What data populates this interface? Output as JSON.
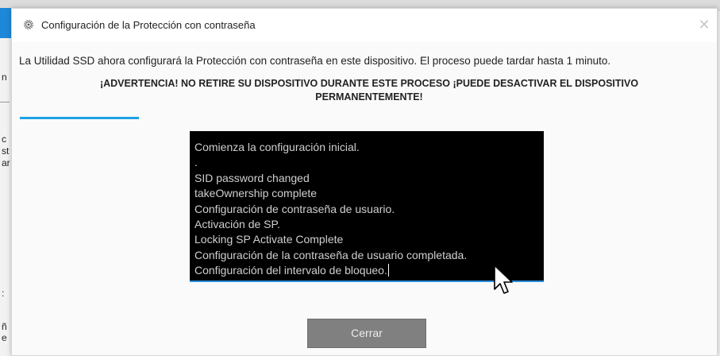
{
  "background": {
    "fragments": [
      "n",
      "c",
      "st",
      "ar",
      ":",
      "ñ",
      "e"
    ]
  },
  "dialog": {
    "title": "Configuración de la Protección con contraseña",
    "close_glyph": "✕",
    "info": "La Utilidad SSD ahora configurará la Protección con contraseña en este dispositivo. El proceso puede tardar hasta 1 minuto.",
    "warning_line1": "¡ADVERTENCIA! NO RETIRE SU DISPOSITIVO DURANTE ESTE PROCESO ¡PUEDE DESACTIVAR EL DISPOSITIVO",
    "warning_line2": "PERMANENTEMENTE!",
    "log": [
      "Comienza la configuración inicial.",
      ".",
      "SID password changed",
      "takeOwnership complete",
      "Configuración de contraseña de usuario.",
      "Activación de SP.",
      "Locking SP Activate Complete",
      "Configuración de la contraseña de usuario completada.",
      "Configuración del intervalo de bloqueo."
    ],
    "close_button_label": "Cerrar"
  },
  "colors": {
    "accent": "#1ea1e6",
    "button_bg": "#808080",
    "log_bg": "#000000",
    "log_text": "#cfcfcf"
  }
}
